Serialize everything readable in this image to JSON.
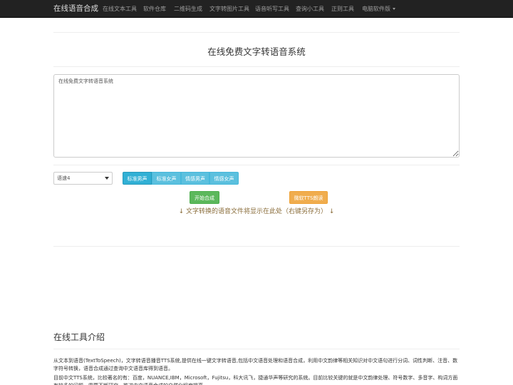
{
  "nav": {
    "brand": "在线语音合成",
    "items": [
      {
        "label": "在线文本工具"
      },
      {
        "label": "软件仓库"
      },
      {
        "label": "二维码生成"
      },
      {
        "label": "文字转图片工具"
      },
      {
        "label": "语音听写工具"
      },
      {
        "label": "查询小工具"
      },
      {
        "label": "正则工具"
      },
      {
        "label": "电脑软件版"
      }
    ]
  },
  "main": {
    "title": "在线免费文字转语音系统",
    "textarea_value": "在线免费文字转语音系统",
    "speed_select": "语速4",
    "voices": [
      "标准男声",
      "标准女声",
      "情感男声",
      "情感女声"
    ],
    "synth_button": "开始合成",
    "ms_tts_button": "微软TTS朗读",
    "hint": "↓ 文字转换的语音文件将显示在此处（右键另存为） ↓"
  },
  "intro": {
    "title": "在线工具介绍",
    "p1": "从文本到语音(TextToSpeech)，文字转语音播音TTS系统,提供在线一键文字转语音,包括中文语音处理和语音合成，利用中文韵律等相关知识对中文语句进行分词、词性判断、注音、数字符号转换，语音合成通过查询中文语音库得到语音。",
    "p2": "目前中文TTS系统，比较著名的有：百度，NUANCE,IBM，Microsoft，Fujitsu，科大讯飞，捷通华声等研究的系统。目前比较关键的就是中文韵律处理、符号数字、多音字、构词方面有较多的问题，需要不断研究，推进中文语音合成的自然化程度提高。"
  },
  "colors": {
    "navbar": "#222222",
    "info": "#5bc0de",
    "success": "#5cb85c",
    "warning": "#f0ad4e",
    "hint_text": "#8a6d3b"
  }
}
